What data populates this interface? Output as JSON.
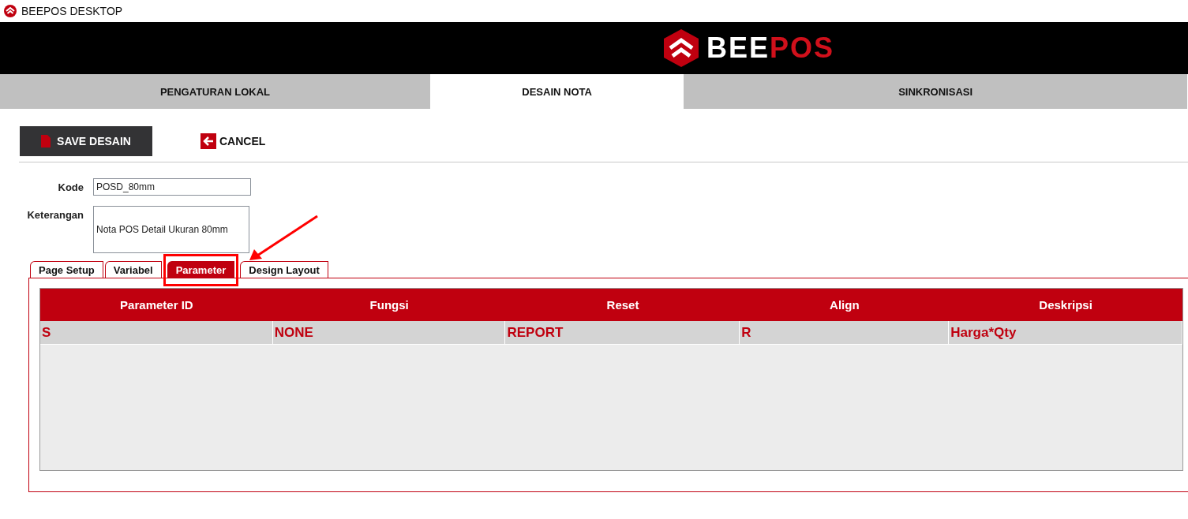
{
  "window": {
    "title": "BEEPOS DESKTOP"
  },
  "header": {
    "logo_primary": "BEE",
    "logo_accent": "POS"
  },
  "nav_tabs": [
    {
      "label": "PENGATURAN LOKAL",
      "selected": false
    },
    {
      "label": "DESAIN NOTA",
      "selected": true
    },
    {
      "label": "SINKRONISASI",
      "selected": false
    }
  ],
  "toolbar": {
    "save": "SAVE DESAIN",
    "cancel": "CANCEL"
  },
  "form": {
    "kode_label": "Kode",
    "kode_value": "POSD_80mm",
    "keterangan_label": "Keterangan",
    "keterangan_value": "Nota POS Detail Ukuran 80mm"
  },
  "sub_tabs": [
    {
      "label": "Page Setup",
      "selected": false,
      "highlighted": false
    },
    {
      "label": "Variabel",
      "selected": false,
      "highlighted": false
    },
    {
      "label": "Parameter",
      "selected": true,
      "highlighted": true
    },
    {
      "label": "Design Layout",
      "selected": false,
      "highlighted": false
    }
  ],
  "table": {
    "columns": [
      "Parameter ID",
      "Fungsi",
      "Reset",
      "Align",
      "Deskripsi"
    ],
    "rows": [
      [
        "S",
        "NONE",
        "REPORT",
        "R",
        "Harga*Qty"
      ]
    ]
  }
}
